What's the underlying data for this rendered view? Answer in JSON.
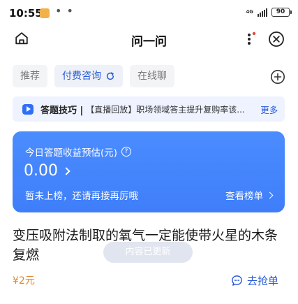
{
  "status_bar": {
    "time": "10:55",
    "dots": "• •",
    "network": "4G",
    "battery": "90"
  },
  "header": {
    "title": "问一问"
  },
  "tabs": [
    {
      "label": "推荐",
      "active": false
    },
    {
      "label": "付费咨询",
      "active": true
    },
    {
      "label": "在线聊",
      "active": false
    }
  ],
  "tips": {
    "title": "答题技巧 |",
    "text": "【直播回放】职场领域答主提升复购率该...",
    "more": "更多"
  },
  "earnings_card": {
    "label": "今日答题收益预估(元)",
    "amount": "0.00",
    "status": "暂未上榜，还请再接再厉哦",
    "link": "查看榜单"
  },
  "question": {
    "text": "变压吸附法制取的氧气一定能使带火星的木条复燃",
    "price": "¥2元",
    "action": "去抢单"
  },
  "toast": "内容已更新",
  "colors": {
    "accent": "#2a5bd7",
    "card": "#4385fb",
    "price": "#e0872a"
  }
}
